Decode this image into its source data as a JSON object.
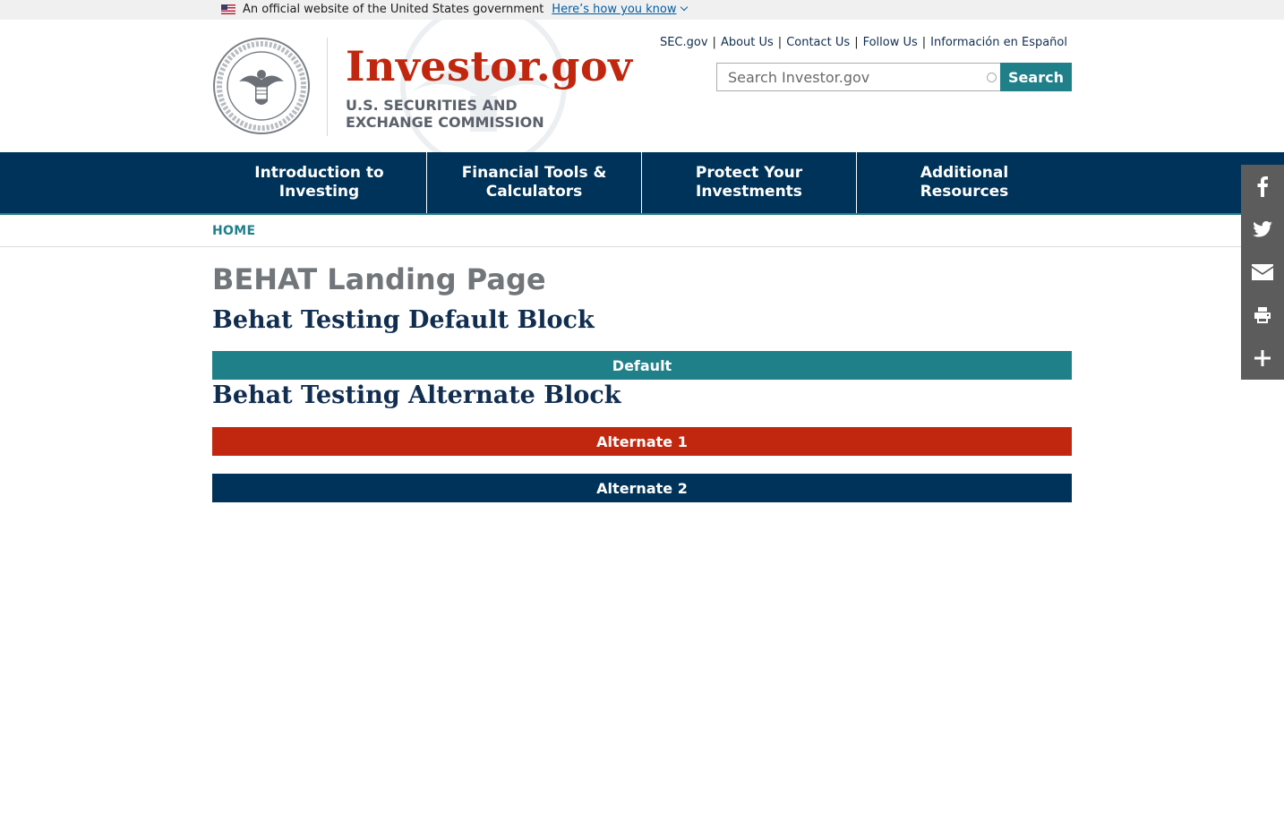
{
  "gov_banner": {
    "text": "An official website of the United States government",
    "link": "Here’s how you know"
  },
  "header": {
    "brand_title": "Investor.gov",
    "brand_sub_line1": "U.S. SECURITIES AND",
    "brand_sub_line2": "EXCHANGE COMMISSION",
    "util_links": [
      "SEC.gov",
      "About Us",
      "Contact Us",
      "Follow Us",
      "Información en Español"
    ],
    "search": {
      "placeholder": "Search Investor.gov",
      "button": "Search"
    }
  },
  "nav": {
    "items": [
      {
        "line1": "Introduction to",
        "line2": "Investing"
      },
      {
        "line1": "Financial Tools &",
        "line2": "Calculators"
      },
      {
        "line1": "Protect Your",
        "line2": "Investments"
      },
      {
        "line1": "Additional",
        "line2": "Resources"
      }
    ]
  },
  "breadcrumb": {
    "home": "HOME"
  },
  "main": {
    "page_title": "BEHAT Landing Page",
    "default_block_heading": "Behat Testing Default Block",
    "default_button": "Default",
    "alternate_block_heading": "Behat Testing Alternate Block",
    "alternate1_button": "Alternate 1",
    "alternate2_button": "Alternate 2"
  },
  "share": {
    "icons": [
      "facebook-icon",
      "twitter-icon",
      "email-icon",
      "print-icon",
      "more-icon"
    ]
  },
  "colors": {
    "brand_red": "#c0270e",
    "navy": "#003359",
    "teal": "#20808a",
    "share_bg": "#5c5c5c"
  }
}
